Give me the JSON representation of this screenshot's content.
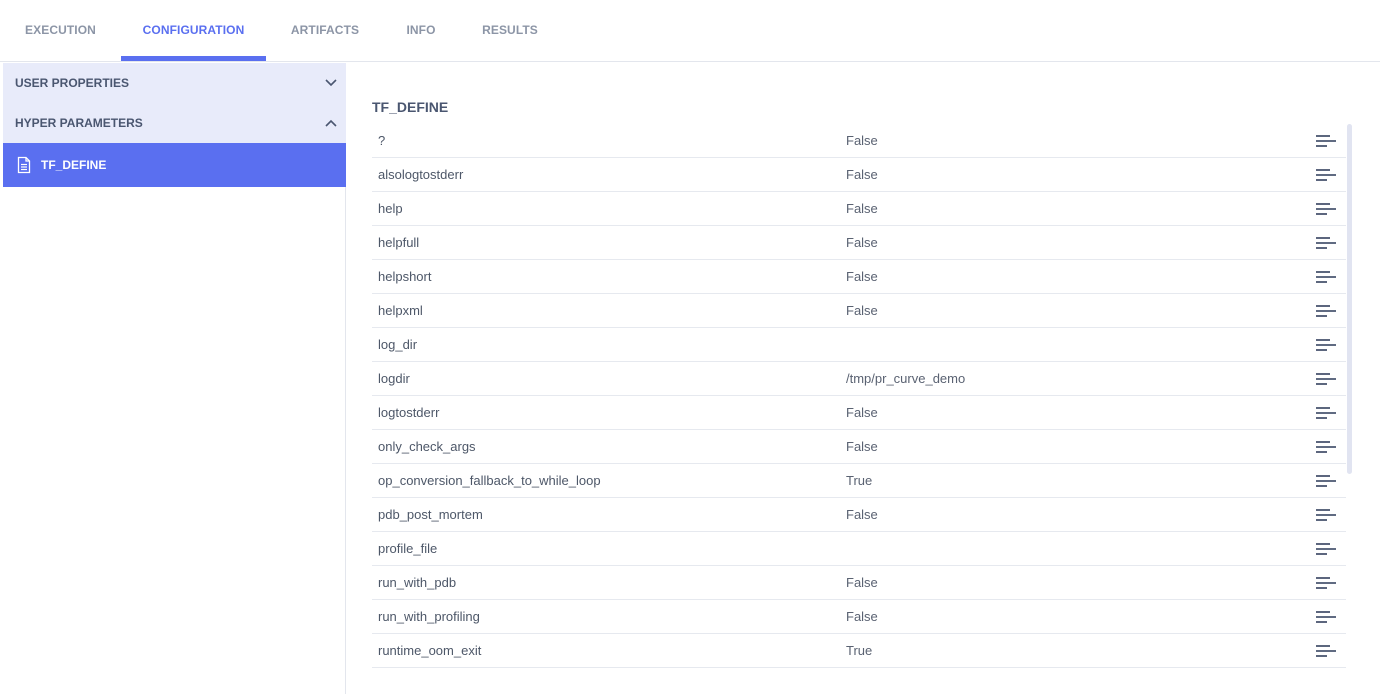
{
  "tabs": [
    {
      "label": "EXECUTION",
      "active": false
    },
    {
      "label": "CONFIGURATION",
      "active": true
    },
    {
      "label": "ARTIFACTS",
      "active": false
    },
    {
      "label": "INFO",
      "active": false
    },
    {
      "label": "RESULTS",
      "active": false
    }
  ],
  "sidebar": {
    "sections": [
      {
        "label": "USER PROPERTIES",
        "expanded": false
      },
      {
        "label": "HYPER PARAMETERS",
        "expanded": true
      }
    ],
    "selected_item": {
      "label": "TF_DEFINE",
      "icon": "file-icon"
    }
  },
  "main": {
    "title": "TF_DEFINE",
    "rows": [
      {
        "key": "?",
        "value": "False"
      },
      {
        "key": "alsologtostderr",
        "value": "False"
      },
      {
        "key": "help",
        "value": "False"
      },
      {
        "key": "helpfull",
        "value": "False"
      },
      {
        "key": "helpshort",
        "value": "False"
      },
      {
        "key": "helpxml",
        "value": "False"
      },
      {
        "key": "log_dir",
        "value": ""
      },
      {
        "key": "logdir",
        "value": "/tmp/pr_curve_demo"
      },
      {
        "key": "logtostderr",
        "value": "False"
      },
      {
        "key": "only_check_args",
        "value": "False"
      },
      {
        "key": "op_conversion_fallback_to_while_loop",
        "value": "True"
      },
      {
        "key": "pdb_post_mortem",
        "value": "False"
      },
      {
        "key": "profile_file",
        "value": ""
      },
      {
        "key": "run_with_pdb",
        "value": "False"
      },
      {
        "key": "run_with_profiling",
        "value": "False"
      },
      {
        "key": "runtime_oom_exit",
        "value": "True"
      }
    ],
    "row_action_icon": "description-icon"
  },
  "colors": {
    "accent": "#5a6ff0",
    "section_bg": "#e8ebfa",
    "text": "#4d5768",
    "tab_inactive": "#8c95a6"
  }
}
